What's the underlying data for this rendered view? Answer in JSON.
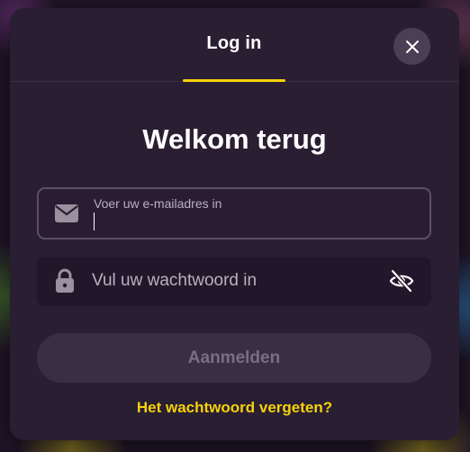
{
  "header": {
    "tab_label": "Log in",
    "close_icon": "close-icon"
  },
  "title": "Welkom terug",
  "email": {
    "label": "Voer uw e-mailadres in",
    "value": "",
    "icon": "envelope-icon"
  },
  "password": {
    "placeholder": "Vul uw wachtwoord in",
    "value": "",
    "icon": "lock-icon",
    "toggle_icon": "eye-off-icon"
  },
  "submit_label": "Aanmelden",
  "forgot_label": "Het wachtwoord vergeten?",
  "colors": {
    "accent": "#f5d20a",
    "modal_bg": "#2a1e33",
    "disabled_button": "#3a2e42"
  }
}
